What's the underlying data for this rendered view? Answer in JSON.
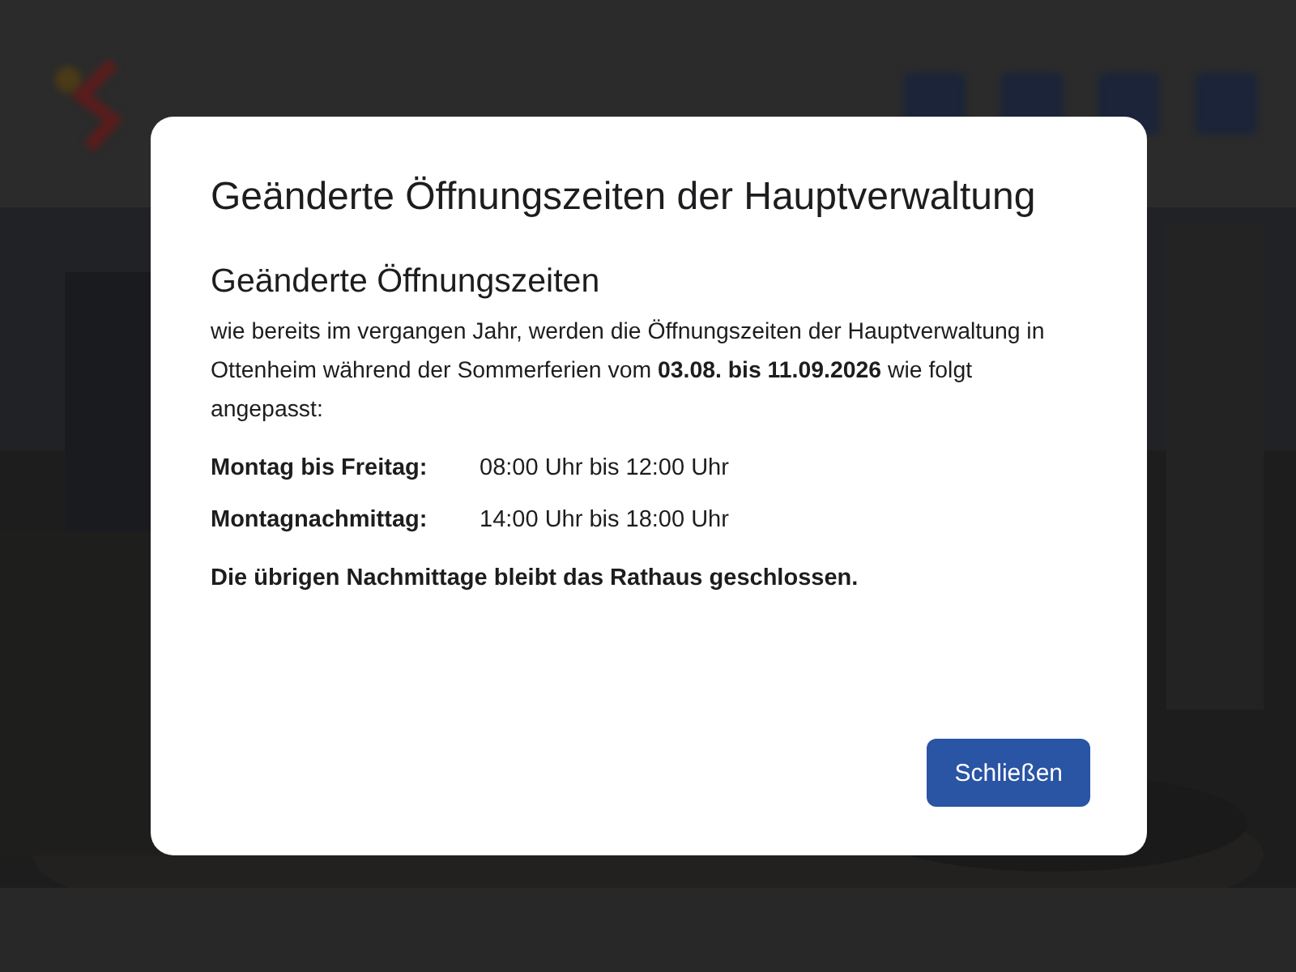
{
  "dialog": {
    "title": "Geänderte Öffnungszeiten der Hauptverwaltung",
    "heading": "Geänderte Öffnungszeiten",
    "intro": "wie bereits im vergangen Jahr, werden die Öffnungszeiten der Hauptverwaltung in Ottenheim während der Sommerferien vom **03.08. bis 11.09.2026** wie folgt angepasst:",
    "hours": [
      {
        "day": "Montag bis Freitag:",
        "time": "08:00 Uhr bis 12:00 Uhr"
      },
      {
        "day": "Montagnachmittag:",
        "time": "14:00 Uhr bis 18:00 Uhr"
      }
    ],
    "note": "Die übrigen Nachmittage bleibt das Rathaus geschlossen.",
    "button": "Schließen"
  }
}
